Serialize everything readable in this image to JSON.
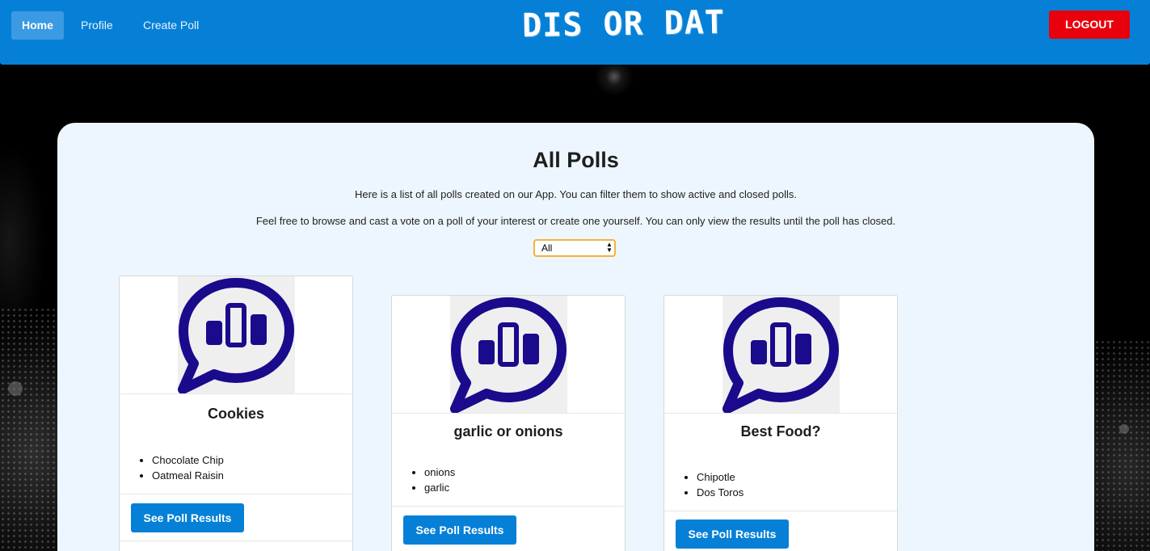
{
  "nav": {
    "home_label": "Home",
    "profile_label": "Profile",
    "create_poll_label": "Create Poll",
    "brand": "DIS OR DAT",
    "logout_label": "LOGOUT"
  },
  "main": {
    "title": "All Polls",
    "description_1": "Here is a list of all polls created on our App. You can filter them to show active and closed polls.",
    "description_2": "Feel free to browse and cast a vote on a poll of your interest or create one yourself. You can only view the results until the poll has closed.",
    "filter": {
      "selected": "All"
    }
  },
  "polls": [
    {
      "icon": "poll-chat-icon",
      "title": "Cookies",
      "options": [
        "Chocolate Chip",
        "Oatmeal Raisin"
      ],
      "button_label": "See Poll Results"
    },
    {
      "icon": "poll-chat-icon",
      "title": "garlic or onions",
      "options": [
        "onions",
        "garlic"
      ],
      "button_label": "See Poll Results"
    },
    {
      "icon": "poll-chat-icon",
      "title": "Best Food?",
      "options": [
        "Chipotle",
        "Dos Toros"
      ],
      "button_label": "See Poll Results"
    }
  ],
  "colors": {
    "primary": "#0680d7",
    "logout": "#e8000c",
    "icon": "#1a0a8c",
    "panel": "#edf6fe"
  }
}
